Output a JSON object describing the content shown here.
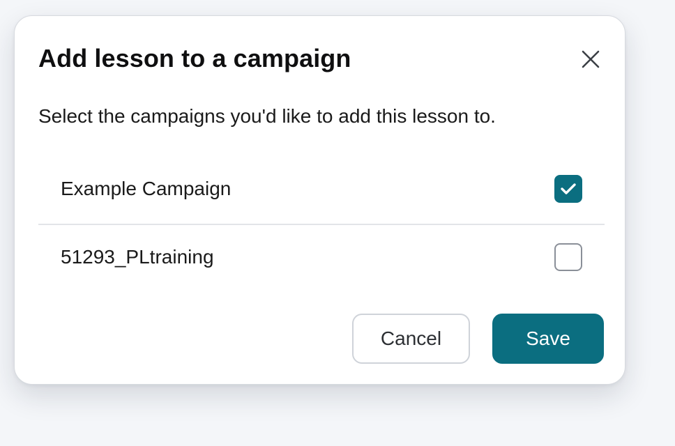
{
  "modal": {
    "title": "Add lesson to a campaign",
    "description": "Select the campaigns you'd like to add this lesson to.",
    "close_icon": "close-icon"
  },
  "campaigns": [
    {
      "label": "Example Campaign",
      "checked": true
    },
    {
      "label": "51293_PLtraining",
      "checked": false
    }
  ],
  "actions": {
    "cancel_label": "Cancel",
    "save_label": "Save"
  },
  "colors": {
    "accent": "#0b6e80",
    "checkbox_border": "#8a8f98"
  }
}
